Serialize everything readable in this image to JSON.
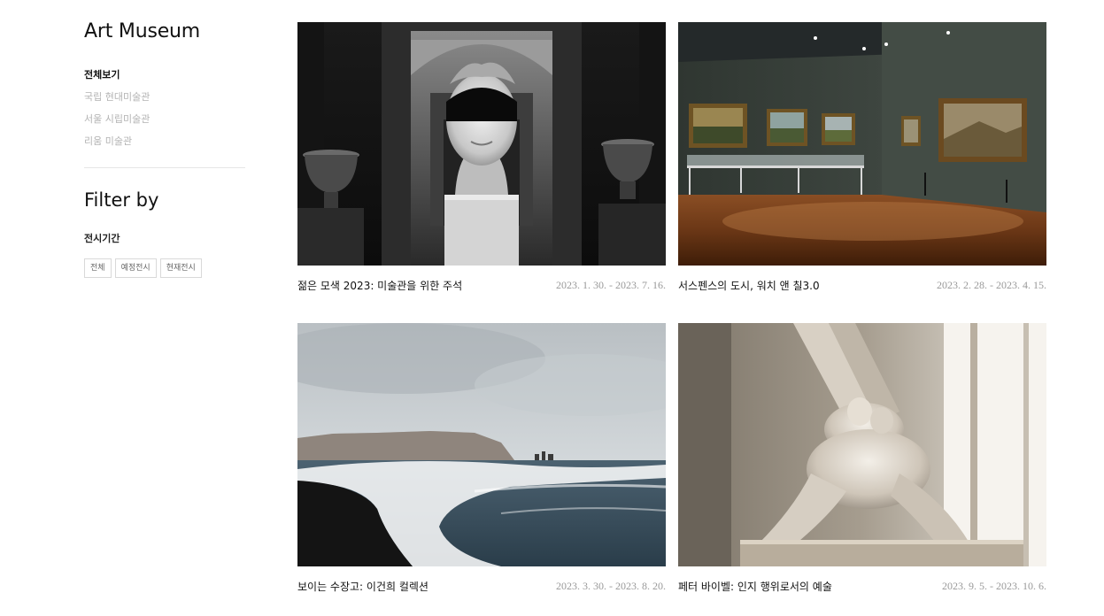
{
  "sidebar": {
    "title": "Art Museum",
    "museums": [
      {
        "label": "전체보기",
        "active": true
      },
      {
        "label": "국립 현대미술관",
        "active": false
      },
      {
        "label": "서울 시립미술관",
        "active": false
      },
      {
        "label": "리움 미술관",
        "active": false
      }
    ],
    "filter_title": "Filter by",
    "period_label": "전시기간",
    "period_buttons": [
      "전체",
      "예정전시",
      "현재전시"
    ]
  },
  "exhibitions": [
    {
      "title": "젊은 모색 2023: 미술관을 위한 주석",
      "dates": "2023. 1. 30. - 2023. 7. 16.",
      "image": "statue-head-photo"
    },
    {
      "title": "서스펜스의 도시, 워치 앤 칠3.0",
      "dates": "2023. 2. 28. - 2023. 4. 15.",
      "image": "gallery-room-photo"
    },
    {
      "title": "보이는 수장고: 이건희 컬렉션",
      "dates": "2023. 3. 30. - 2023. 8. 20.",
      "image": "black-sand-beach-photo"
    },
    {
      "title": "페터 바이벨: 인지 행위로서의 예술",
      "dates": "2023. 9. 5. - 2023. 10. 6.",
      "image": "marble-sculpture-photo"
    }
  ]
}
